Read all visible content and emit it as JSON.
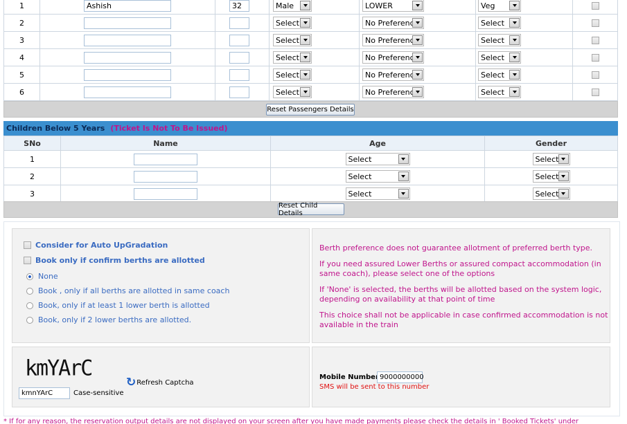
{
  "passengers": {
    "rows": [
      {
        "sno": "1",
        "name": "Ashish",
        "age": "32",
        "gender": "Male",
        "berth": "LOWER",
        "food": "Veg"
      },
      {
        "sno": "2",
        "name": "",
        "age": "",
        "gender": "Select",
        "berth": "No Preference",
        "food": "Select"
      },
      {
        "sno": "3",
        "name": "",
        "age": "",
        "gender": "Select",
        "berth": "No Preference",
        "food": "Select"
      },
      {
        "sno": "4",
        "name": "",
        "age": "",
        "gender": "Select",
        "berth": "No Preference",
        "food": "Select"
      },
      {
        "sno": "5",
        "name": "",
        "age": "",
        "gender": "Select",
        "berth": "No Preference",
        "food": "Select"
      },
      {
        "sno": "6",
        "name": "",
        "age": "",
        "gender": "Select",
        "berth": "No Preference",
        "food": "Select"
      }
    ],
    "reset_label": "Reset Passengers Details"
  },
  "children": {
    "title": "Children Below 5 Years",
    "note": "(Ticket Is Not To Be Issued)",
    "headers": {
      "sno": "SNo",
      "name": "Name",
      "age": "Age",
      "gender": "Gender"
    },
    "rows": [
      {
        "sno": "1",
        "age": "Select",
        "gender": "Select"
      },
      {
        "sno": "2",
        "age": "Select",
        "gender": "Select"
      },
      {
        "sno": "3",
        "age": "Select",
        "gender": "Select"
      }
    ],
    "reset_label": "Reset Child Details"
  },
  "options": {
    "auto_upgrade": "Consider for Auto UpGradation",
    "confirm_only": "Book only if confirm berths are allotted",
    "radios": [
      {
        "label": "None",
        "checked": true
      },
      {
        "label": "Book , only if all berths are allotted in same coach",
        "checked": false
      },
      {
        "label": "Book, only if at least 1 lower berth is allotted",
        "checked": false
      },
      {
        "label": "Book, only if 2 lower berths are allotted.",
        "checked": false
      }
    ]
  },
  "info": {
    "p1": "Berth preference does not guarantee allotment of preferred berth type.",
    "p2a": "If you need assured Lower Berths or assured compact accommodation (in",
    "p2b": "same coach), please select one of the options",
    "p3a": "If 'None' is selected, the berths will be allotted based on the system logic,",
    "p3b": "depending on availability at that point of time",
    "p4a": "This choice shall not be applicable in case confirmed accommodation is not",
    "p4b": "available in the train"
  },
  "captcha": {
    "image_text": "kmYArC",
    "input_value": "kmnYArC",
    "case_label": "Case-sensitive",
    "refresh_label": "Refresh Captcha"
  },
  "mobile": {
    "label": "Mobile Number :",
    "value": "9000000000",
    "note": "SMS will be sent to this number"
  },
  "footer": "* If for any reason, the reservation output details are not displayed on your screen after you have made payments please check the details in ' Booked Tickets' under"
}
